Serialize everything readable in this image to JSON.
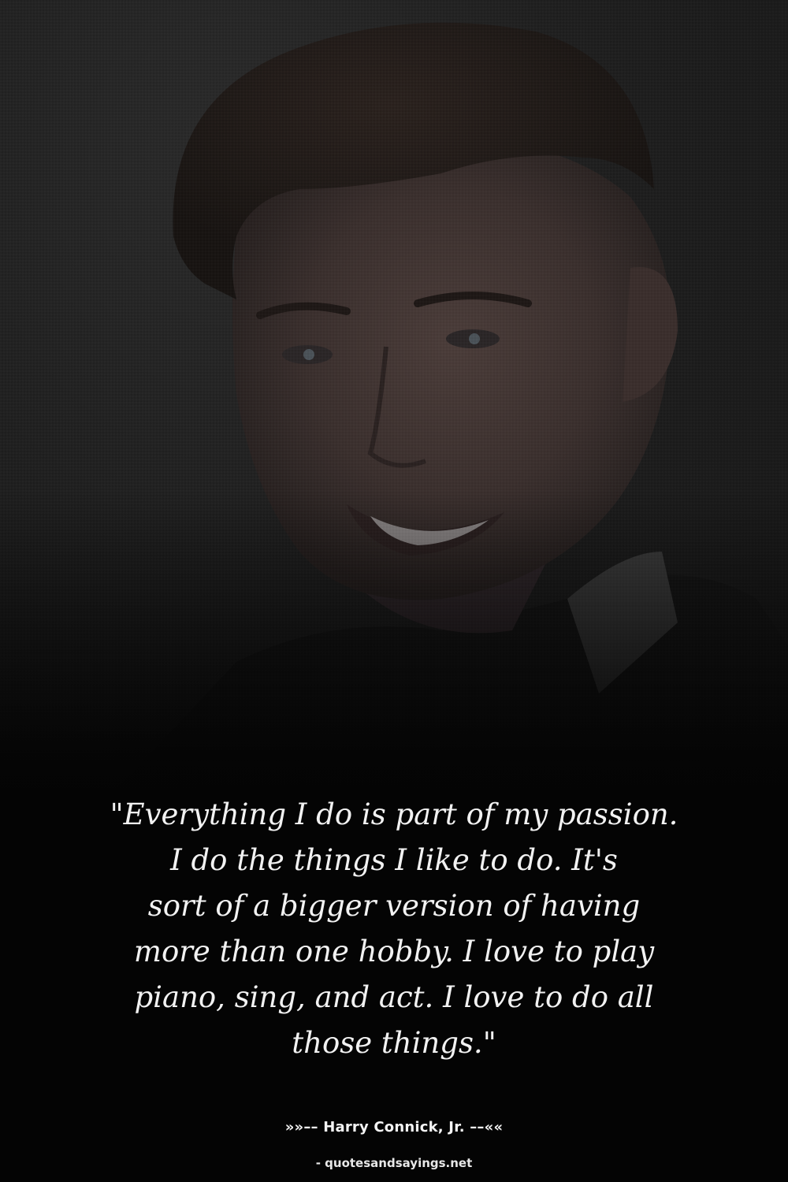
{
  "quote": {
    "lines": [
      "\"Everything I do is part of my passion.",
      "I do the things I like to do. It's",
      "sort of a bigger version of having",
      "more than one hobby. I love to play",
      "piano, sing, and act. I love to do all",
      "those things.\""
    ]
  },
  "attribution": {
    "author": "»»–– Harry Connick, Jr. ––««"
  },
  "watermark": {
    "site": "- quotesandsayings.net"
  },
  "colors": {
    "background": "#040404",
    "text": "#f2f2f2"
  }
}
